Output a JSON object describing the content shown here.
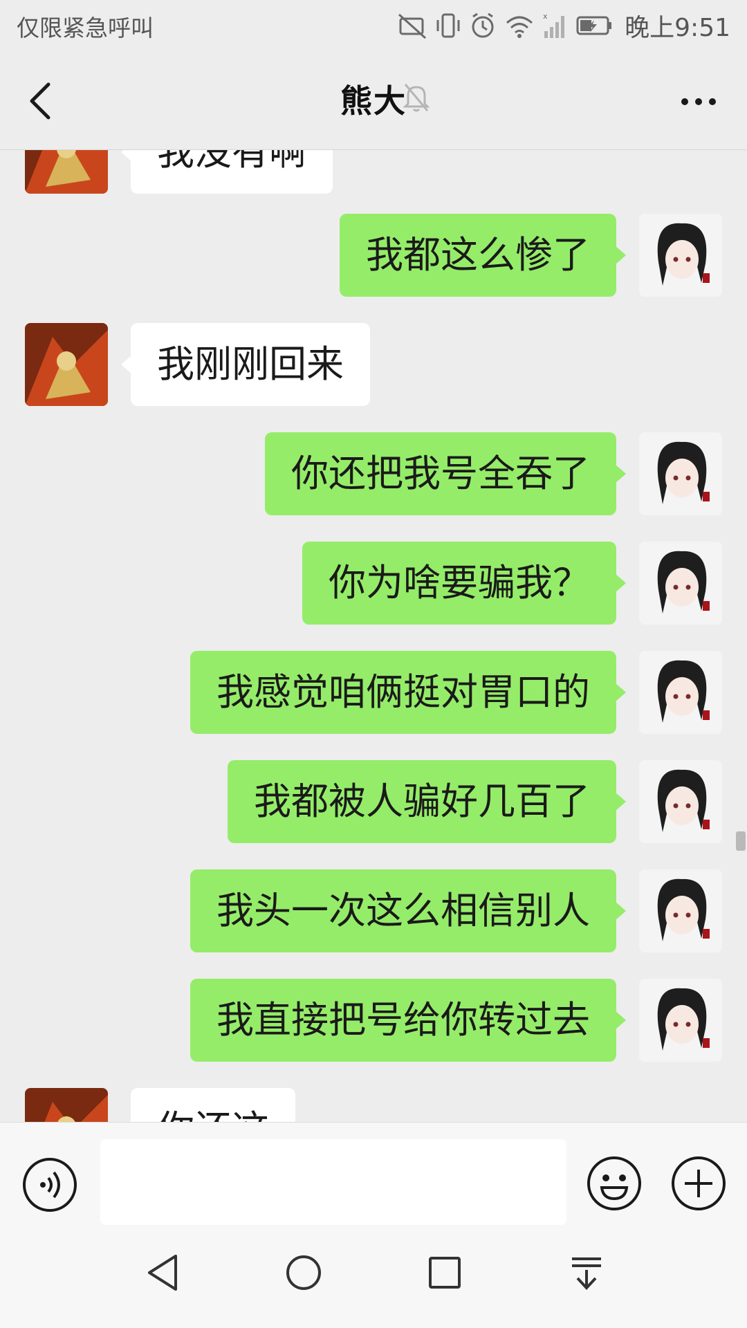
{
  "status_bar": {
    "carrier_text": "仅限紧急呼叫",
    "time": "晚上9:51",
    "icons": [
      "no-sim-icon",
      "vibrate-icon",
      "alarm-icon",
      "wifi-icon",
      "signal-icon",
      "battery-charging-icon"
    ]
  },
  "header": {
    "title": "熊大",
    "back_icon": "back-chevron-icon",
    "mute_icon": "bell-muted-icon",
    "more_icon": "more-dots-icon"
  },
  "messages": [
    {
      "from": "contact",
      "text": "我没有啊"
    },
    {
      "from": "me",
      "text": "我都这么惨了"
    },
    {
      "from": "contact",
      "text": "我刚刚回来"
    },
    {
      "from": "me",
      "text": "你还把我号全吞了"
    },
    {
      "from": "me",
      "text": "你为啥要骗我？"
    },
    {
      "from": "me",
      "text": "我感觉咱俩挺对胃口的"
    },
    {
      "from": "me",
      "text": "我都被人骗好几百了"
    },
    {
      "from": "me",
      "text": "我头一次这么相信别人"
    },
    {
      "from": "me",
      "text": "我直接把号给你转过去"
    },
    {
      "from": "contact",
      "text": "你还这"
    }
  ],
  "input_bar": {
    "voice_icon": "voice-icon",
    "text_value": "",
    "emoji_icon": "emoji-icon",
    "plus_icon": "plus-circle-icon"
  },
  "nav_bar": {
    "icons": [
      "nav-back-icon",
      "nav-home-icon",
      "nav-recents-icon",
      "nav-notification-icon"
    ]
  },
  "colors": {
    "background": "#ededed",
    "outgoing_bubble": "#95ec69",
    "incoming_bubble": "#ffffff"
  }
}
